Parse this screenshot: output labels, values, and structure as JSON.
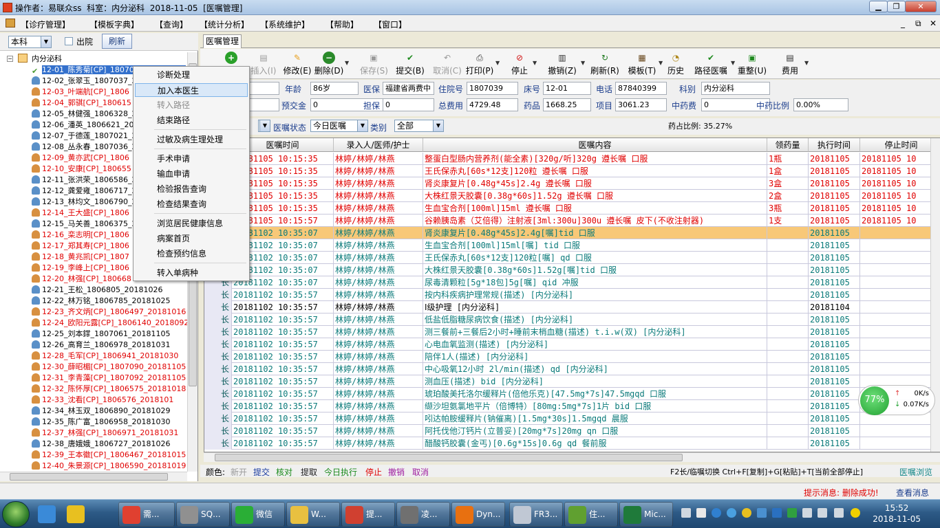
{
  "window": {
    "title": "操作者：易联众ss  科室：内分泌科  2018-11-05  [医嘱管理]"
  },
  "menu": [
    "【诊疗管理】",
    "【模板字典】",
    "【查询】",
    "【统计分析】",
    "【系统维护】",
    "【帮助】",
    "【窗口】"
  ],
  "left": {
    "dept": "本科",
    "discharged": "出院",
    "refresh": "刷新",
    "root": "内分泌科",
    "patients": [
      {
        "t": "12-01_陈秀菊[CP]_1807039_20181102",
        "red": true,
        "sel": true
      },
      {
        "t": "12-02_张翠玉_1807037_20181102",
        "red": false
      },
      {
        "t": "12-03_叶端航[CP]_1806",
        "red": true
      },
      {
        "t": "12-04_郭骐[CP]_180615",
        "red": true
      },
      {
        "t": "12-05_林健强_1806328_20181019",
        "red": false
      },
      {
        "t": "12-06_潘英_1806621_20181024",
        "red": false
      },
      {
        "t": "12-07_于德莲_1807021_20181102",
        "red": false
      },
      {
        "t": "12-08_丛永春_1807036_20181102",
        "red": false
      },
      {
        "t": "12-09_黄亦武[CP]_1806",
        "red": true
      },
      {
        "t": "12-10_安康[CP]_180655",
        "red": true
      },
      {
        "t": "12-11_张洪荣_1806586_20181023",
        "red": false
      },
      {
        "t": "12-12_龚爱雍_1806717_20181026",
        "red": false
      },
      {
        "t": "12-13_林均文_1806790_20181027",
        "red": false
      },
      {
        "t": "12-14_王大盛[CP]_1806",
        "red": true
      },
      {
        "t": "12-15_马关善_1806375_20181020",
        "red": false
      },
      {
        "t": "12-16_栾志明[CP]_1806",
        "red": true
      },
      {
        "t": "12-17_郑其寿[CP]_1806",
        "red": true
      },
      {
        "t": "12-18_黄兆凯[CP]_1807",
        "red": true
      },
      {
        "t": "12-19_李峰上[CP]_1806",
        "red": true
      },
      {
        "t": "12-20_林强[CP]_180668",
        "red": true
      },
      {
        "t": "12-21_王松_1806805_20181026",
        "red": false
      },
      {
        "t": "12-22_林万铭_1806785_20181025",
        "red": false
      },
      {
        "t": "12-23_齐文炳[CP]_1806497_20181016",
        "red": true
      },
      {
        "t": "12-24_欧阳元露[CP]_1806140_2018092",
        "red": true
      },
      {
        "t": "12-25_刘本鐣_1807061_20181105",
        "red": false
      },
      {
        "t": "12-26_高育兰_1806978_20181031",
        "red": false
      },
      {
        "t": "12-28_毛军[CP]_1806941_20181030",
        "red": true
      },
      {
        "t": "12-30_薛昭楣[CP]_1807090_20181105",
        "red": true
      },
      {
        "t": "12-31_李青藻[CP]_1807092_20181105",
        "red": true
      },
      {
        "t": "12-32_陈怀厚[CP]_1806575_20181018",
        "red": true
      },
      {
        "t": "12-33_沈看[CP]_1806576_2018101",
        "red": true
      },
      {
        "t": "12-34_林玉双_1806890_20181029",
        "red": false
      },
      {
        "t": "12-35_陈广富_1806958_20181030",
        "red": false
      },
      {
        "t": "12-37_林强[CP]_1806971_20181031",
        "red": true
      },
      {
        "t": "12-38_唐娥娥_1806727_20181026",
        "red": false
      },
      {
        "t": "12-39_王本徽[CP]_1806467_20181015",
        "red": true
      },
      {
        "t": "12-40_朱景源[CP]_1806590_20181019",
        "red": true
      }
    ]
  },
  "context_menu": [
    {
      "label": "诊断处理",
      "dis": false
    },
    {
      "label": "加入本医生",
      "dis": false,
      "hl": true
    },
    {
      "label": "转入路径",
      "dis": true
    },
    {
      "label": "结束路径",
      "dis": false,
      "sep": true
    },
    {
      "label": "过敏及病生理处理",
      "dis": false,
      "sep": true
    },
    {
      "label": "手术申请",
      "dis": false
    },
    {
      "label": "输血申请",
      "dis": false
    },
    {
      "label": "检验报告查询",
      "dis": false
    },
    {
      "label": "检查结果查询",
      "dis": false,
      "sep": true
    },
    {
      "label": "浏览居民健康信息",
      "dis": false
    },
    {
      "label": "病案首页",
      "dis": false
    },
    {
      "label": "检查预约信息",
      "dis": false,
      "sep": true
    },
    {
      "label": "转入单病种",
      "dis": false
    }
  ],
  "tab": "医嘱管理",
  "toolbar": [
    {
      "label": "",
      "icon": "plus-circle-icon",
      "g": "+",
      "c": "#1f9a1f"
    },
    {
      "label": "插入(I)",
      "icon": "insert-icon",
      "g": "▤",
      "c": "#9a9a9a",
      "dis": true
    },
    {
      "label": "修改(E)",
      "icon": "edit-icon",
      "g": "✎",
      "c": "#e8a020"
    },
    {
      "label": "删除(D)",
      "icon": "delete-icon",
      "g": "−",
      "c": "#1f8a1f",
      "arrow": true
    },
    {
      "label": "保存(S)",
      "icon": "save-icon",
      "g": "▣",
      "c": "#9a9a9a",
      "dis": true
    },
    {
      "label": "提交(B)",
      "icon": "submit-icon",
      "g": "✔",
      "c": "#1f8a1f"
    },
    {
      "label": "取消(C)",
      "icon": "cancel-icon",
      "g": "↶",
      "c": "#9a9a9a",
      "dis": true
    },
    {
      "label": "打印(P)",
      "icon": "print-icon",
      "g": "⎙",
      "c": "#303030",
      "arrow": true
    },
    {
      "label": "停止",
      "icon": "stop-icon",
      "g": "⊘",
      "c": "#d01010",
      "arrow": true
    },
    {
      "label": "撤销(Z)",
      "icon": "undo-icon",
      "g": "▥",
      "c": "#303030",
      "arrow": true
    },
    {
      "label": "刷新(R)",
      "icon": "refresh-icon",
      "g": "↻",
      "c": "#1f7a1f"
    },
    {
      "label": "模板(T)",
      "icon": "template-icon",
      "g": "▦",
      "c": "#6a4a20",
      "arrow": true
    },
    {
      "label": "历史",
      "icon": "history-icon",
      "g": "◔",
      "c": "#b08a20"
    },
    {
      "label": "路径医嘱",
      "icon": "pathway-icon",
      "g": "✔",
      "c": "#1f8a1f",
      "arrow": true
    },
    {
      "label": "重整(U)",
      "icon": "reorganize-icon",
      "g": "▣",
      "c": "#1f8a1f"
    },
    {
      "label": "费用",
      "icon": "fee-icon",
      "g": "▤",
      "c": "#303030",
      "arrow": true
    }
  ],
  "info": {
    "name_label": "",
    "name": "菊",
    "age_label": "年龄",
    "age": "86岁",
    "ins_label": "医保",
    "ins": "福建省两费中",
    "adm_label": "住院号",
    "adm": "1807039",
    "bed_label": "床号",
    "bed": "12-01",
    "tel_label": "电话",
    "tel": "87840399",
    "dept_label": "科别",
    "dept": "内分泌科",
    "v1": "48",
    "prepay_label": "预交金",
    "prepay": "0",
    "guar_label": "担保",
    "guar": "0",
    "total_label": "总费用",
    "total": "4729.48",
    "drug_label": "药品",
    "drug": "1668.25",
    "item_label": "项目",
    "item": "3061.23",
    "cmed_label": "中药费",
    "cmed": "0",
    "cratio_label": "中药比例",
    "cratio": "0.00%"
  },
  "filter": {
    "state_label": "医嘱状态",
    "state": "今日医嘱",
    "cat_label": "类别",
    "cat": "全部",
    "ratio": "药占比例: 35.27%"
  },
  "grid": {
    "headers": [
      "医嘱时间",
      "录入人/医师/护士",
      "医嘱内容",
      "领药量",
      "执行时间",
      "停止时间"
    ],
    "rows": [
      {
        "k": "",
        "t": "20181105 10:15:35",
        "d": "林婷/林婷/林燕",
        "c": "整蛋白型肠内营养剂(能全素)[320g/听]320g 遵长嘱 口服",
        "q": "1瓶",
        "e": "20181105",
        "s": "20181105 10",
        "red": true
      },
      {
        "k": "",
        "t": "20181105 10:15:35",
        "d": "林婷/林婷/林燕",
        "c": "王氏保赤丸[60s*12支]120粒 遵长嘱 口服",
        "q": "1盒",
        "e": "20181105",
        "s": "20181105 10",
        "red": true
      },
      {
        "k": "",
        "t": "20181105 10:15:35",
        "d": "林婷/林婷/林燕",
        "c": "肾炎康复片[0.48g*45s]2.4g 遵长嘱 口服",
        "q": "3盒",
        "e": "20181105",
        "s": "20181105 10",
        "red": true
      },
      {
        "k": "",
        "t": "20181105 10:15:35",
        "d": "林婷/林婷/林燕",
        "c": "大株红景天胶囊[0.38g*60s]1.52g 遵长嘱 口服",
        "q": "2盒",
        "e": "20181105",
        "s": "20181105 10",
        "red": true
      },
      {
        "k": "",
        "t": "20181105 10:15:35",
        "d": "林婷/林婷/林燕",
        "c": "生血宝合剂[100ml]15ml 遵长嘱 口服",
        "q": "3瓶",
        "e": "20181105",
        "s": "20181105 10",
        "red": true
      },
      {
        "k": "",
        "t": "20181105 10:15:57",
        "d": "林婷/林婷/林燕",
        "c": "谷赖胰岛素（艾倍得）注射液[3ml:300u]300u 遵长嘱 皮下(不收注射器)",
        "q": "1支",
        "e": "20181105",
        "s": "20181105 10",
        "red": true
      },
      {
        "k": "",
        "t": "20181102 10:35:07",
        "d": "林婷/林婷/林燕",
        "c": "肾炎康复片[0.48g*45s]2.4g[嘱]tid 口服",
        "q": "",
        "e": "20181105",
        "s": "",
        "hl": true
      },
      {
        "k": "",
        "t": "20181102 10:35:07",
        "d": "林婷/林婷/林燕",
        "c": "生血宝合剂[100ml]15ml[嘱] tid 口服",
        "q": "",
        "e": "20181105",
        "s": ""
      },
      {
        "k": "",
        "t": "20181102 10:35:07",
        "d": "林婷/林婷/林燕",
        "c": "王氏保赤丸[60s*12支]120粒[嘱] qd 口服",
        "q": "",
        "e": "20181105",
        "s": ""
      },
      {
        "k": "",
        "t": "20181102 10:35:07",
        "d": "林婷/林婷/林燕",
        "c": "大株红景天胶囊[0.38g*60s]1.52g[嘱]tid 口服",
        "q": "",
        "e": "20181105",
        "s": ""
      },
      {
        "k": "长",
        "t": "20181102 10:35:07",
        "d": "林婷/林婷/林燕",
        "c": "尿毒清颗粒[5g*18包]5g[嘱] qid 冲服",
        "q": "",
        "e": "20181105",
        "s": ""
      },
      {
        "k": "长",
        "t": "20181102 10:35:57",
        "d": "林婷/林婷/林燕",
        "c": "按内科疾病护理常规(描述)   [内分泌科]",
        "q": "",
        "e": "20181105",
        "s": ""
      },
      {
        "k": "长",
        "t": "20181102 10:35:57",
        "d": "林婷/林婷/林燕",
        "c": "Ⅰ级护理   [内分泌科]",
        "q": "",
        "e": "20181104",
        "s": "",
        "black": true
      },
      {
        "k": "长",
        "t": "20181102 10:35:57",
        "d": "林婷/林婷/林燕",
        "c": "低盐低脂糖尿病饮食(描述)   [内分泌科]",
        "q": "",
        "e": "20181105",
        "s": ""
      },
      {
        "k": "长",
        "t": "20181102 10:35:57",
        "d": "林婷/林婷/林燕",
        "c": "测三餐前+三餐后2小时+睡前末梢血糖(描述) t.i.w(双)  [内分泌科]",
        "q": "",
        "e": "20181105",
        "s": ""
      },
      {
        "k": "长",
        "t": "20181102 10:35:57",
        "d": "林婷/林婷/林燕",
        "c": "心电血氧监测(描述)   [内分泌科]",
        "q": "",
        "e": "20181105",
        "s": ""
      },
      {
        "k": "长",
        "t": "20181102 10:35:57",
        "d": "林婷/林婷/林燕",
        "c": "陪伴1人(描述)   [内分泌科]",
        "q": "",
        "e": "20181105",
        "s": ""
      },
      {
        "k": "长",
        "t": "20181102 10:35:57",
        "d": "林婷/林婷/林燕",
        "c": "中心吸氧12小时 2l/min(描述) qd  [内分泌科]",
        "q": "",
        "e": "20181105",
        "s": ""
      },
      {
        "k": "长",
        "t": "20181102 10:35:57",
        "d": "林婷/林婷/林燕",
        "c": "测血压(描述) bid  [内分泌科]",
        "q": "",
        "e": "20181105",
        "s": ""
      },
      {
        "k": "长",
        "t": "20181102 10:35:57",
        "d": "林婷/林婷/林燕",
        "c": "琥珀酸美托洛尔缓释片(倍他乐克)[47.5mg*7s]47.5mgqd 口服",
        "q": "",
        "e": "20181105",
        "s": ""
      },
      {
        "k": "长",
        "t": "20181102 10:35:57",
        "d": "林婷/林婷/林燕",
        "c": "缬沙坦氨氯地平片（倍博特）[80mg:5mg*7s]1片 bid 口服",
        "q": "",
        "e": "20181105",
        "s": ""
      },
      {
        "k": "长",
        "t": "20181102 10:35:57",
        "d": "林婷/林婷/林燕",
        "c": "吲达帕胺缓释片(钠催离)[1.5mg*30s]1.5mgqd 晨服",
        "q": "",
        "e": "20181105",
        "s": ""
      },
      {
        "k": "长",
        "t": "20181102 10:35:57",
        "d": "林婷/林婷/林燕",
        "c": "阿托伐他汀钙片(立普妥)[20mg*7s]20mg qn 口服",
        "q": "",
        "e": "20181105",
        "s": ""
      },
      {
        "k": "长",
        "t": "20181102 10:35:57",
        "d": "林婷/林婷/林燕",
        "c": "醋酸钙胶囊(金丐)[0.6g*15s]0.6g qd 餐前服",
        "q": "",
        "e": "20181105",
        "s": ""
      }
    ]
  },
  "legend": {
    "label": "颜色:",
    "items": [
      {
        "t": "新开",
        "c": "#9a9a9a"
      },
      {
        "t": "提交",
        "c": "#1a3ca0"
      },
      {
        "t": "核对",
        "c": "#1a8a1a"
      },
      {
        "t": "提取",
        "c": "#202020"
      },
      {
        "t": "今日执行",
        "c": "#1a8a1a"
      },
      {
        "t": "停止",
        "c": "#e00000"
      },
      {
        "t": "撤销",
        "c": "#a020a0"
      },
      {
        "t": "取消",
        "c": "#a020a0"
      }
    ],
    "hint": "F2长/临嘱切换 Ctrl+F[复制]+G[粘贴]+T[当前全部停止]",
    "browse": "医嘱浏览"
  },
  "status": {
    "msg": "提示消息: 删除成功!",
    "view": "查看消息>>"
  },
  "net": {
    "pct": "77%",
    "up": "0K/s",
    "down": "0.07K/s"
  },
  "taskbar": {
    "items": [
      {
        "label": "",
        "icon": "browser-icon",
        "c": "#3a8ad8"
      },
      {
        "label": "",
        "icon": "qq-icon",
        "c": "#e8c020"
      },
      {
        "label": "需...",
        "icon": "chrome-icon",
        "c": "#e04030"
      },
      {
        "label": "SQ...",
        "icon": "sql-icon",
        "c": "#909090"
      },
      {
        "label": "微信",
        "icon": "wechat-icon",
        "c": "#2aae36"
      },
      {
        "label": "W...",
        "icon": "folder-icon",
        "c": "#e8c040"
      },
      {
        "label": "提...",
        "icon": "doctor-icon",
        "c": "#d04030"
      },
      {
        "label": "凌...",
        "icon": "cat-icon",
        "c": "#707070"
      },
      {
        "label": "Dyn...",
        "icon": "dyn-icon",
        "c": "#e87010"
      },
      {
        "label": "FR3...",
        "icon": "tools-icon",
        "c": "#c0c8d4"
      },
      {
        "label": "住...",
        "icon": "report-icon",
        "c": "#60a030"
      },
      {
        "label": "Mic...",
        "icon": "excel-icon",
        "c": "#1f7a3a"
      }
    ],
    "time": "15:52",
    "date": "2018-11-05"
  }
}
